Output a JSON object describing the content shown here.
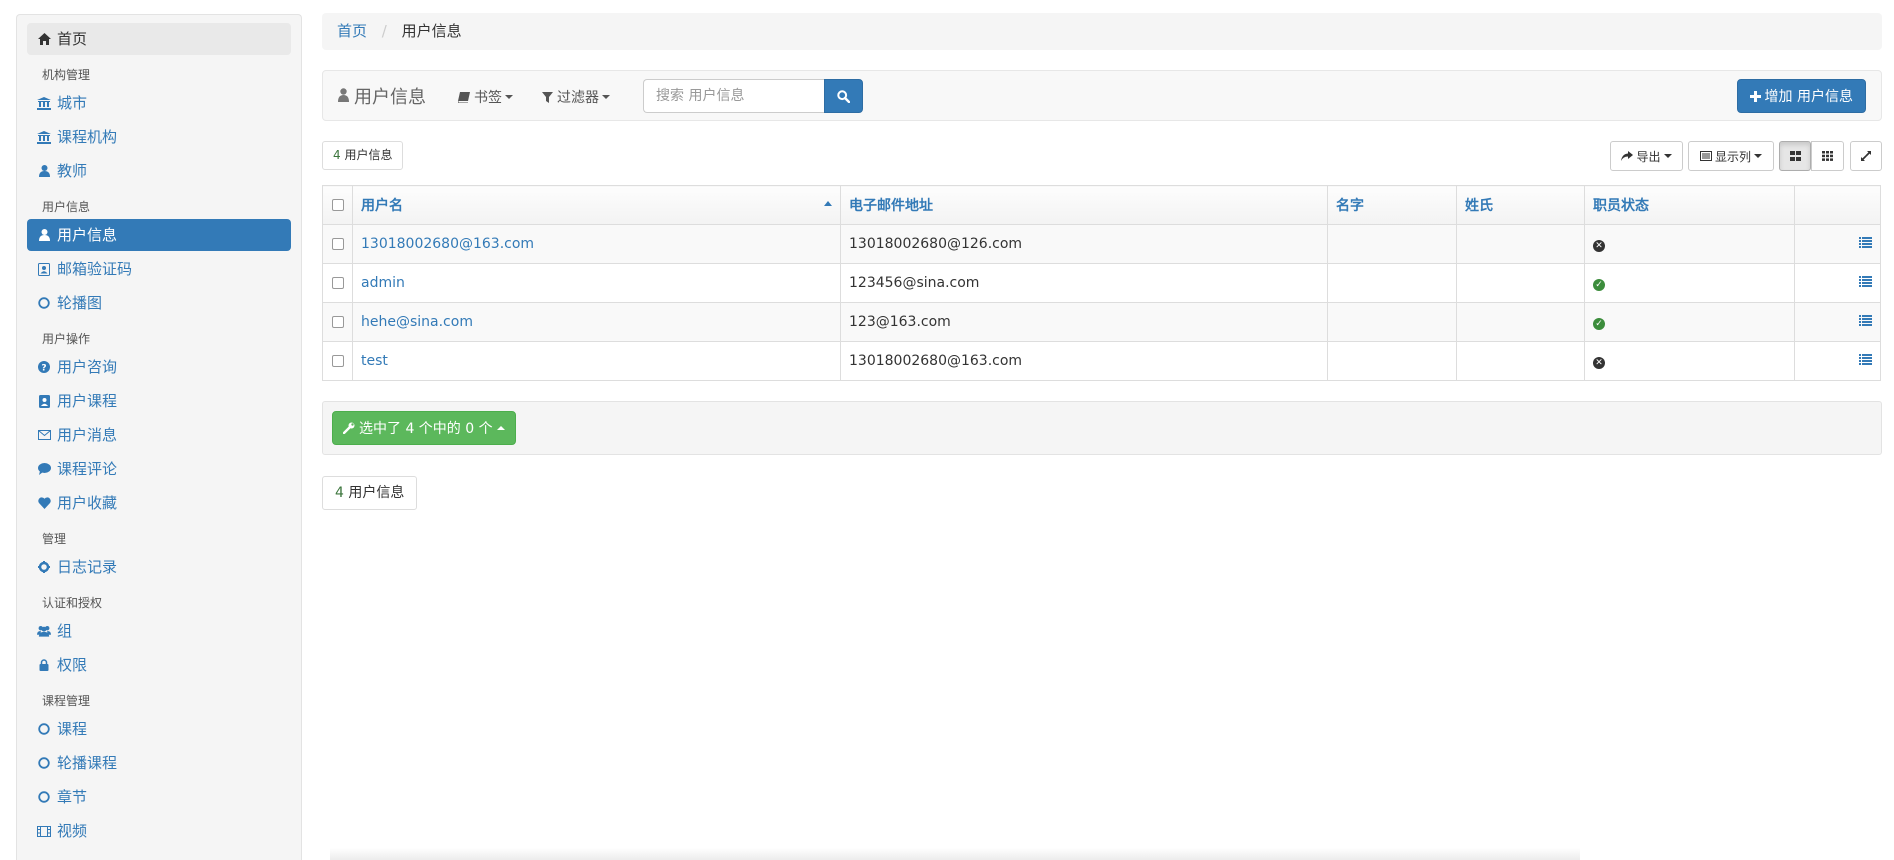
{
  "breadcrumb": {
    "home": "首页",
    "current": "用户信息"
  },
  "sidebar": {
    "home": "首页",
    "sections": [
      {
        "header": "机构管理",
        "items": [
          "城市",
          "课程机构",
          "教师"
        ]
      },
      {
        "header": "用户信息",
        "items": [
          "用户信息",
          "邮箱验证码",
          "轮播图"
        ]
      },
      {
        "header": "用户操作",
        "items": [
          "用户咨询",
          "用户课程",
          "用户消息",
          "课程评论",
          "用户收藏"
        ]
      },
      {
        "header": "管理",
        "items": [
          "日志记录"
        ]
      },
      {
        "header": "认证和授权",
        "items": [
          "组",
          "权限"
        ]
      },
      {
        "header": "课程管理",
        "items": [
          "课程",
          "轮播课程",
          "章节",
          "视频"
        ]
      }
    ],
    "active_item": "用户信息"
  },
  "toolbar": {
    "title": "用户信息",
    "bookmarks": "书签",
    "filters": "过滤器",
    "search_placeholder": "搜索 用户信息",
    "add_label": "增加 用户信息"
  },
  "result_count": {
    "num": "4",
    "label": "用户信息"
  },
  "list_tools": {
    "export": "导出",
    "columns": "显示列"
  },
  "table": {
    "columns": [
      "用户名",
      "电子邮件地址",
      "名字",
      "姓氏",
      "职员状态"
    ],
    "rows": [
      {
        "username": "13018002680@163.com",
        "email": "13018002680@126.com",
        "first_name": "",
        "last_name": "",
        "is_staff": false
      },
      {
        "username": "admin",
        "email": "123456@sina.com",
        "first_name": "",
        "last_name": "",
        "is_staff": true
      },
      {
        "username": "hehe@sina.com",
        "email": "123@163.com",
        "first_name": "",
        "last_name": "",
        "is_staff": true
      },
      {
        "username": "test",
        "email": "13018002680@163.com",
        "first_name": "",
        "last_name": "",
        "is_staff": false
      }
    ]
  },
  "actions": {
    "label": "选中了 4 个中的 0 个"
  },
  "footer_count": {
    "num": "4",
    "label": "用户信息"
  },
  "colors": {
    "primary": "#337ab7",
    "success": "#5cb85c",
    "ok_icon": "#3c8d3c",
    "no_icon": "#333333"
  }
}
